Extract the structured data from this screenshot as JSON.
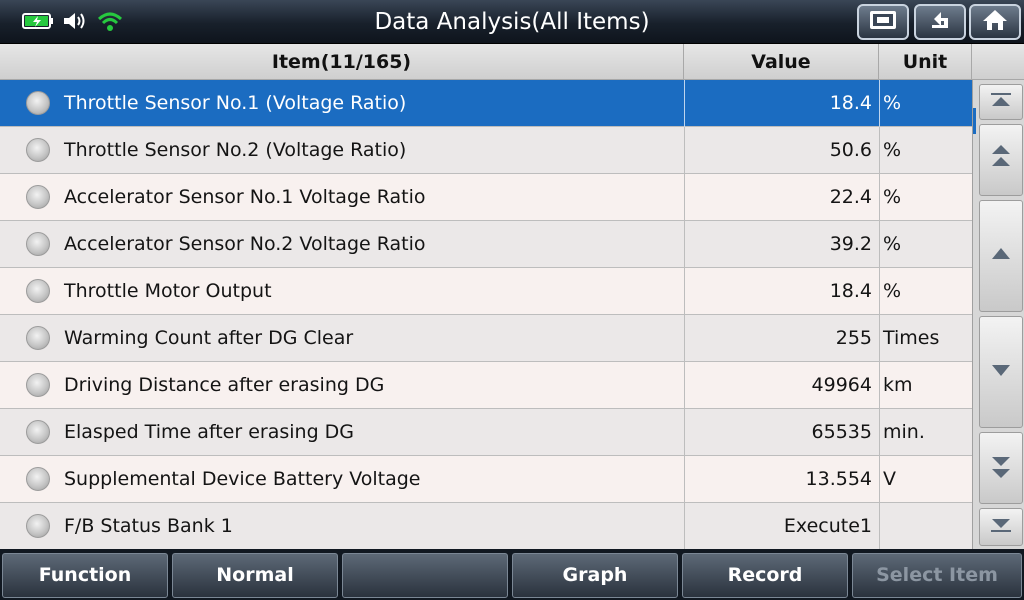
{
  "title": "Data Analysis(All Items)",
  "status_icons": [
    "battery-charging-icon",
    "speaker-icon",
    "wifi-icon"
  ],
  "toolbar": {
    "buttons": [
      "screen-capture-icon",
      "back-icon",
      "home-icon"
    ]
  },
  "table": {
    "headers": {
      "item": "Item(11/165)",
      "value": "Value",
      "unit": "Unit"
    },
    "rows": [
      {
        "name": "Throttle Sensor No.1 (Voltage Ratio)",
        "value": "18.4",
        "unit": "%",
        "selected": true
      },
      {
        "name": "Throttle Sensor No.2 (Voltage Ratio)",
        "value": "50.6",
        "unit": "%"
      },
      {
        "name": "Accelerator Sensor No.1 Voltage Ratio",
        "value": "22.4",
        "unit": "%"
      },
      {
        "name": "Accelerator Sensor No.2 Voltage Ratio",
        "value": "39.2",
        "unit": "%"
      },
      {
        "name": "Throttle Motor Output",
        "value": "18.4",
        "unit": "%"
      },
      {
        "name": "Warming Count after DG Clear",
        "value": "255",
        "unit": "Times"
      },
      {
        "name": "Driving Distance after erasing DG",
        "value": "49964",
        "unit": "km"
      },
      {
        "name": "Elasped Time after erasing DG",
        "value": "65535",
        "unit": "min."
      },
      {
        "name": "Supplemental Device Battery Voltage",
        "value": "13.554",
        "unit": "V"
      },
      {
        "name": "F/B Status Bank 1",
        "value": "Execute1",
        "unit": ""
      }
    ]
  },
  "bottom_bar": {
    "function": "Function",
    "normal": "Normal",
    "blank": "",
    "graph": "Graph",
    "record": "Record",
    "select_item": "Select Item"
  },
  "colors": {
    "selected_row": "#1b6cc1",
    "title_bar": "#18202b",
    "bottom_bar": "#111821"
  }
}
